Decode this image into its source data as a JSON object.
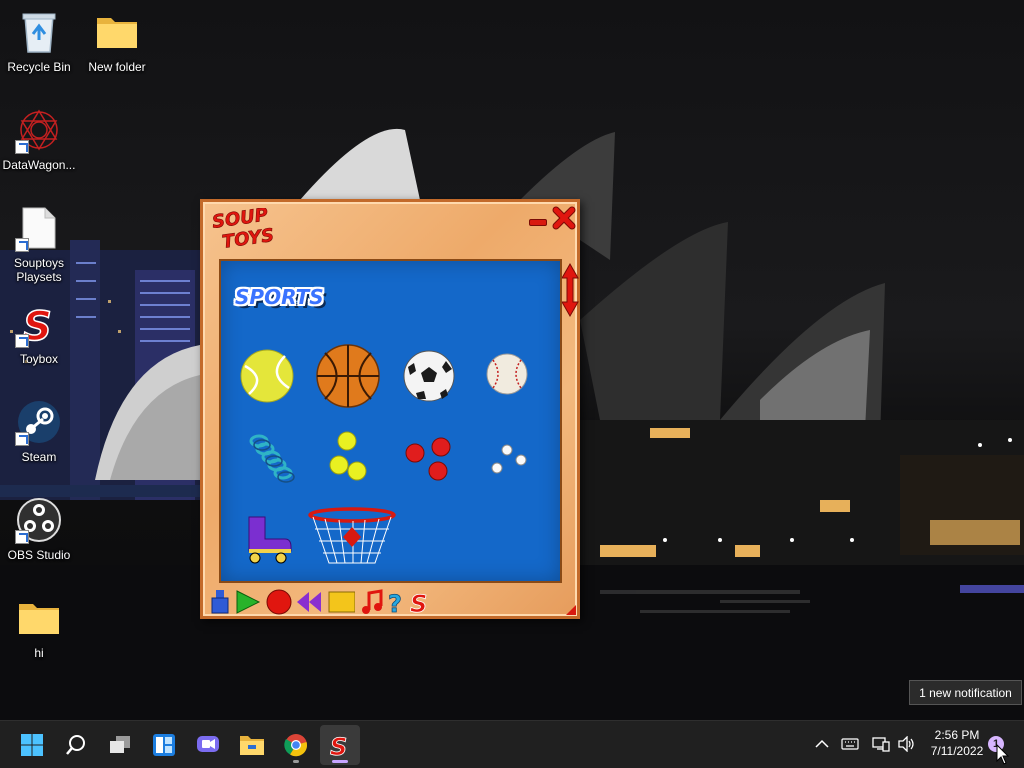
{
  "desktop": {
    "icons": [
      {
        "label": "Recycle Bin",
        "icon": "recycle-bin-icon"
      },
      {
        "label": "New folder",
        "icon": "folder-icon"
      },
      {
        "label": "DataWagon...",
        "icon": "datawagon-icon"
      },
      {
        "label": "Souptoys Playsets",
        "icon": "document-icon"
      },
      {
        "label": "Toybox",
        "icon": "souptoys-icon"
      },
      {
        "label": "Steam",
        "icon": "steam-icon"
      },
      {
        "label": "OBS Studio",
        "icon": "obs-icon"
      },
      {
        "label": "hi",
        "icon": "folder-icon"
      }
    ]
  },
  "soup_window": {
    "logo_text_line1": "SOUP",
    "logo_text_line2": "TOYS",
    "category": "SPORTS",
    "toys": [
      {
        "name": "tennis-ball"
      },
      {
        "name": "basketball"
      },
      {
        "name": "soccer-ball"
      },
      {
        "name": "baseball"
      },
      {
        "name": "slinky-spring"
      },
      {
        "name": "yellow-balls"
      },
      {
        "name": "red-balls"
      },
      {
        "name": "white-balls"
      },
      {
        "name": "roller-skate"
      },
      {
        "name": "basketball-hoop"
      }
    ],
    "toolbar": [
      {
        "name": "flask-tool"
      },
      {
        "name": "play-tool"
      },
      {
        "name": "record-tool"
      },
      {
        "name": "rewind-tool"
      },
      {
        "name": "square-tool"
      },
      {
        "name": "music-tool"
      },
      {
        "name": "help-tool"
      },
      {
        "name": "souptoys-tool"
      }
    ],
    "colors": {
      "frame": "#f3b97e",
      "panel": "#1468c9",
      "accent_red": "#d8190f"
    }
  },
  "notification": {
    "tooltip": "1 new notification",
    "badge": "1"
  },
  "taskbar": {
    "buttons": [
      "start-button",
      "search-button",
      "task-view-button",
      "widgets-button",
      "chat-button",
      "file-explorer-button",
      "chrome-button",
      "souptoys-taskbar-button"
    ],
    "active": "souptoys-taskbar-button"
  },
  "clock": {
    "time": "2:56 PM",
    "date": "7/11/2022"
  }
}
